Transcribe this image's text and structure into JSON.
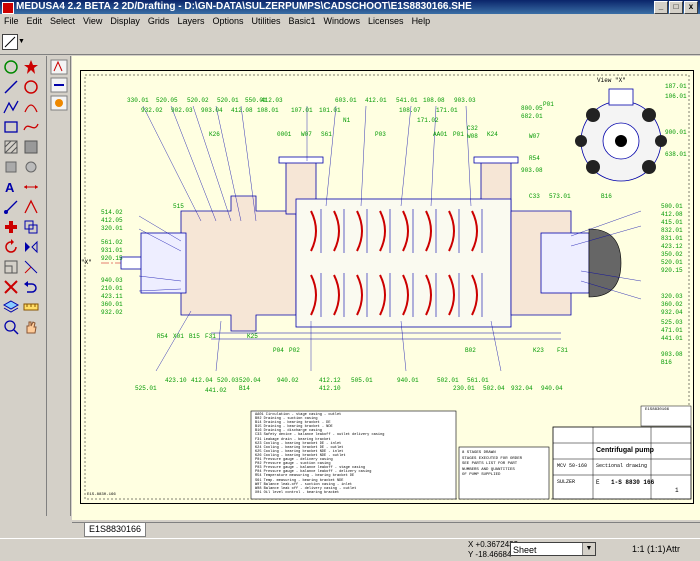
{
  "window": {
    "title": "MEDUSA4 2.2 BETA 2 2D/Drafting - D:\\GN-DATA\\SULZERPUMPS\\CADSCHOOT\\E1S8830166.SHE"
  },
  "menu": [
    "File",
    "Edit",
    "Select",
    "View",
    "Display",
    "Grids",
    "Layers",
    "Options",
    "Utilities",
    "Basic1",
    "Windows",
    "Licenses",
    "Help"
  ],
  "tabs": {
    "active": "E1S8830166"
  },
  "status": {
    "x": "X +0.3672433",
    "y": "Y -18.46684",
    "sheet": "Sheet",
    "zoom": "1:1 (1:1)",
    "attr": "Attr"
  },
  "drawing": {
    "view_label": "View \"X\"",
    "x_marker": "\"X\"",
    "labels_top": [
      "330.01",
      "520.05",
      "520.02",
      "520.01",
      "550.01",
      "412.08",
      "108.01",
      "603.01",
      "412.01",
      "541.01",
      "108.08",
      "903.03",
      "171.01",
      "932.02",
      "902.03",
      "903.04",
      "412.03",
      "107.01",
      "101.01",
      "108.07",
      "171.02",
      "N1",
      "K26",
      "0001",
      "W07",
      "S61",
      "P03",
      "AA01",
      "P01",
      "C32",
      "K24",
      "W08"
    ],
    "labels_left": [
      "514.02",
      "412.05",
      "320.01",
      "561.02",
      "931.01",
      "920.15",
      "940.03",
      "210.01",
      "423.11",
      "360.01",
      "932.02"
    ],
    "labels_right": [
      "500.01",
      "412.08",
      "415.01",
      "832.01",
      "831.01",
      "423.12",
      "350.02",
      "520.01",
      "920.15",
      "320.03",
      "360.02",
      "932.04",
      "525.03",
      "471.01",
      "441.01",
      "903.08",
      "B16"
    ],
    "labels_bottom": [
      "525.01",
      "423.10",
      "412.04",
      "520.03",
      "441.02",
      "520.04",
      "B14",
      "940.02",
      "412.12",
      "412.10",
      "505.01",
      "940.01",
      "502.01",
      "230.01",
      "561.01",
      "502.04",
      "932.04",
      "940.04"
    ],
    "labels_mid": [
      "R54",
      "X01",
      "B15",
      "F31",
      "K25",
      "P04",
      "P02",
      "C33",
      "573.01",
      "B16",
      "515",
      "K23",
      "F31",
      "B02"
    ],
    "view_labels": [
      "P01",
      "187.01",
      "106.01",
      "800.05",
      "682.01",
      "W07",
      "R54",
      "903.08",
      "900.01",
      "638.01"
    ],
    "legend": [
      "AA01 Circulation - stage casing - outlet",
      "B02  Draining - suction casing",
      "B14  Draining - bearing bracket - DE",
      "B15  Draining - bearing bracket - NDE",
      "B16  Draining - discharge casing",
      "C33  Safety device - balance leakoff - outlet delivery casing",
      "F31  Leakage drain - bearing bracket",
      "K23  Cooling - bearing bracket DE - inlet",
      "K24  Cooling - bearing bracket DE - outlet",
      "K25  Cooling - bearing bracket NDE - inlet",
      "K26  Cooling - bearing bracket NDE - outlet",
      "P01  Pressure gauge - delivery casing",
      "P02  Pressure gauge - suction casing",
      "P03  Pressure gauge - balance leakoff - stage casing",
      "P04  Pressure gauge - balance leakoff - delivery casing",
      "R54  Temperature measuring - bearing bracket DE",
      "S61  Temp. measuring - bearing bracket NDE",
      "W07  Balance leak-off - suction casing - inlet",
      "W08  Balance leak off - delivery casing - outlet",
      "X01  Oil level control - bearing bracket"
    ],
    "notes": [
      "8 STAGES DRAWN",
      "STAGES EXECUTED FOR ORDER",
      "SEE PARTS LIST FOR PART",
      "NUMBERS AND QUANTITIES",
      "OF PUMP SUPPLIED"
    ],
    "title_block": {
      "title": "Centrifugal pump",
      "subtitle": "Sectional drawing",
      "model": "MCV 50-160",
      "company": "SULZER",
      "number": "1-S 8830 166",
      "sheet_code": "E1S8830166",
      "rev": "E",
      "sheet": "1",
      "drawing_no_small": "E1S-8830-166"
    }
  },
  "colors": {
    "accent": "#0a246a",
    "drawing_bg": "#ffffe1",
    "label_green": "#00a000",
    "section_red": "#c80000",
    "outline_blue": "#0000a0"
  }
}
